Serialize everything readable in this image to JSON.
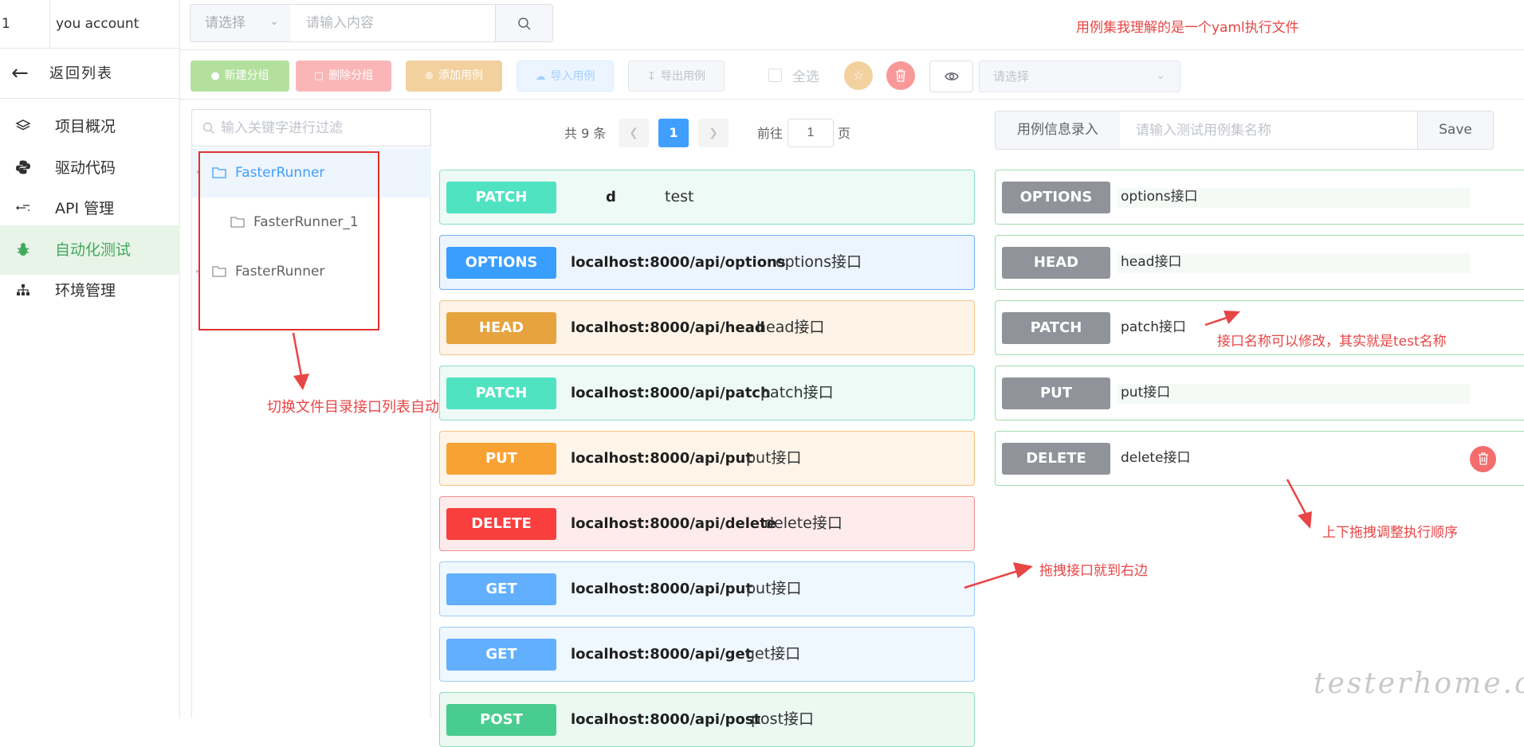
{
  "account": {
    "number": "1",
    "name": "you account"
  },
  "sidebar": {
    "back_label": "返回列表",
    "items": [
      {
        "label": "项目概况",
        "icon": "layers-icon"
      },
      {
        "label": "驱动代码",
        "icon": "python-icon"
      },
      {
        "label": "API 管理",
        "icon": "api-icon"
      },
      {
        "label": "自动化测试",
        "icon": "bug-icon",
        "active": true
      },
      {
        "label": "环境管理",
        "icon": "sitemap-icon"
      }
    ]
  },
  "topbar": {
    "select_placeholder": "请选择",
    "search_placeholder": "请输入内容"
  },
  "toolbar": {
    "new_group": "新建分组",
    "delete_group": "删除分组",
    "add_case": "添加用例",
    "import_case": "导入用例",
    "export_case": "导出用例",
    "select_all": "全选",
    "env_placeholder": "请选择"
  },
  "tree": {
    "filter_placeholder": "输入关键字进行过滤",
    "nodes": [
      {
        "label": "FasterRunner"
      },
      {
        "label": "FasterRunner_1"
      },
      {
        "label": "FasterRunner"
      }
    ]
  },
  "pagination": {
    "total": "共 9 条",
    "current": "1",
    "goto_label": "前往",
    "goto_value": "1",
    "page_label": "页"
  },
  "api_list": [
    {
      "method": "PATCH",
      "url": "d",
      "desc": "test"
    },
    {
      "method": "OPTIONS",
      "url": "localhost:8000/api/options",
      "desc": "options接口"
    },
    {
      "method": "HEAD",
      "url": "localhost:8000/api/head",
      "desc": "head接口"
    },
    {
      "method": "PATCH",
      "url": "localhost:8000/api/patch",
      "desc": "patch接口"
    },
    {
      "method": "PUT",
      "url": "localhost:8000/api/put",
      "desc": "put接口"
    },
    {
      "method": "DELETE",
      "url": "localhost:8000/api/delete",
      "desc": "delete接口"
    },
    {
      "method": "GET",
      "url": "localhost:8000/api/put",
      "desc": "put接口"
    },
    {
      "method": "GET",
      "url": "localhost:8000/api/get",
      "desc": "get接口"
    },
    {
      "method": "POST",
      "url": "localhost:8000/api/post",
      "desc": "post接口"
    }
  ],
  "case_panel": {
    "label": "用例信息录入",
    "input_placeholder": "请输入测试用例集名称",
    "save": "Save",
    "steps": [
      {
        "method": "OPTIONS",
        "name": "options接口"
      },
      {
        "method": "HEAD",
        "name": "head接口"
      },
      {
        "method": "PATCH",
        "name": "patch接口"
      },
      {
        "method": "PUT",
        "name": "put接口"
      },
      {
        "method": "DELETE",
        "name": "delete接口"
      }
    ]
  },
  "annotations": {
    "top": "用例集我理解的是一个yaml执行文件",
    "tree": "切换文件目录接口列表自动更新",
    "rename": "接口名称可以修改，其实就是test名称",
    "drag": "拖拽接口就到右边",
    "order": "上下拖拽调整执行顺序"
  },
  "watermark": "testerhome.com",
  "colors": {
    "accent": "#409eff",
    "active_green": "#42a85c",
    "annotation_red": "#e84545",
    "patch": "#49e0b6",
    "options": "#3a9eff",
    "head": "#e6a33e",
    "put": "#f7a133",
    "delete": "#f93e3e",
    "get": "#61affe",
    "post": "#49cc90",
    "step_gray": "#909399"
  }
}
